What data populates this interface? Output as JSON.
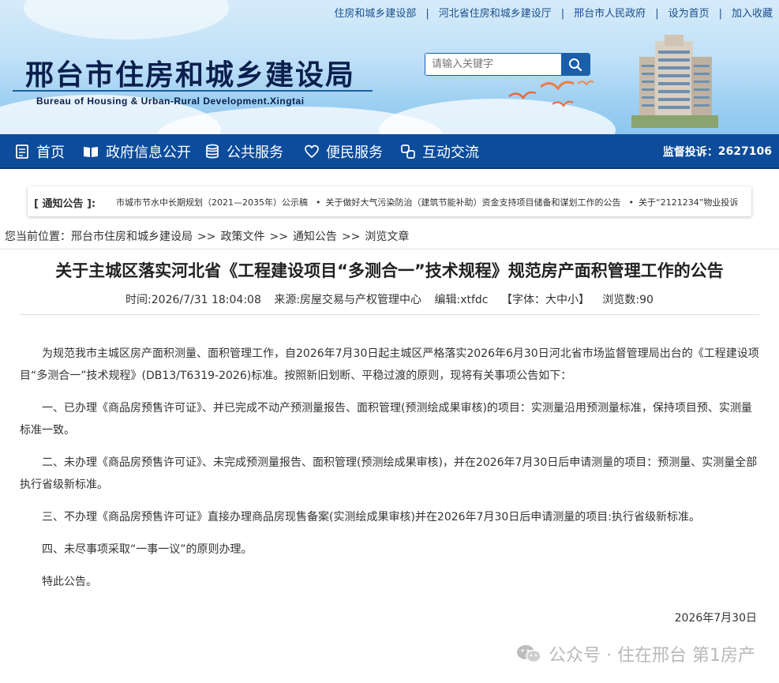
{
  "toplinks": [
    "住房和城乡建设部",
    "河北省住房和城乡建设厅",
    "邢台市人民政府",
    "设为首页",
    "加入收藏"
  ],
  "site": {
    "title": "邢台市住房和城乡建设局",
    "subtitle": "Bureau of Housing & Urban-Rural Development.Xingtai"
  },
  "search": {
    "placeholder": "请输入关键字"
  },
  "nav": {
    "items": [
      "首页",
      "政府信息公开",
      "公共服务",
      "便民服务",
      "互动交流"
    ],
    "hotline_label": "监督投诉：",
    "hotline_number": "2627106"
  },
  "notice": {
    "tag": "[ 通知公告 ]:",
    "items": [
      "市城市节水中长期规划（2021—2035年）公示稿",
      "关于做好大气污染防治（建筑节能补助）资金支持项目储备和谋划工作的公告",
      "关于“2121234”物业投诉"
    ]
  },
  "breadcrumb": {
    "label": "您当前位置：",
    "items": [
      "邢台市住房和城乡建设局",
      "政策文件",
      "通知公告",
      "浏览文章"
    ]
  },
  "article": {
    "title": "关于主城区落实河北省《工程建设项目“多测合一”技术规程》规范房产面积管理工作的公告",
    "time": "时间:2026/7/31 18:04:08",
    "source": "来源:房屋交易与产权管理中心",
    "editor": "编辑:xtfdc",
    "font_label_open": "【字体：",
    "font_large": "大",
    "font_medium": "中",
    "font_small": "小",
    "font_label_close": "】",
    "views": "浏览数:90",
    "paragraphs": [
      "为规范我市主城区房产面积测量、面积管理工作，自2026年7月30日起主城区严格落实2026年6月30日河北省市场监督管理局出台的《工程建设项目“多测合一”技术规程》(DB13/T6319-2026)标准。按照新旧划断、平稳过渡的原则，现将有关事项公告如下：",
      "一、已办理《商品房预售许可证》、并已完成不动产预测量报告、面积管理(预测绘成果审核)的项目：实测量沿用预测量标准，保持项目预、实测量标准一致。",
      "二、未办理《商品房预售许可证》、未完成预测量报告、面积管理(预测绘成果审核)，并在2026年7月30日后申请测量的项目：预测量、实测量全部执行省级新标准。",
      "三、不办理《商品房预售许可证》直接办理商品房现售备案(实测绘成果审核)并在2026年7月30日后申请测量的项目:执行省级新标准。",
      "四、未尽事项采取“一事一议”的原则办理。",
      "特此公告。"
    ],
    "date": "2026年7月30日"
  },
  "watermark": "公众号 · 住在邢台 第1房产"
}
